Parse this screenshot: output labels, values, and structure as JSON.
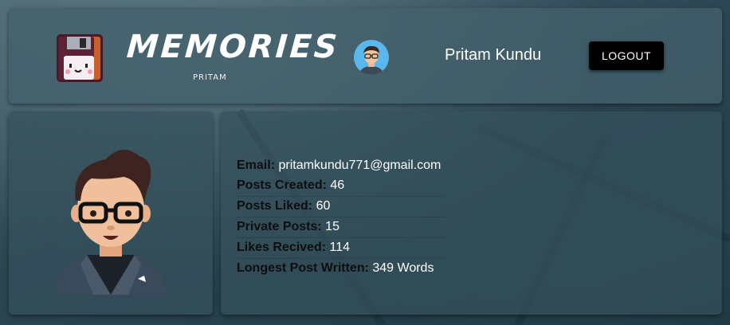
{
  "header": {
    "brand_title": "MEMORIES",
    "brand_subtitle": "PRITAM",
    "user_name": "Pritam Kundu",
    "logout_label": "LOGOUT"
  },
  "profile": {
    "email": {
      "label": "Email:",
      "value": "pritamkundu771@gmail.com"
    },
    "posts_created": {
      "label": "Posts Created:",
      "value": "46"
    },
    "posts_liked": {
      "label": "Posts Liked:",
      "value": "60"
    },
    "private_posts": {
      "label": "Private Posts:",
      "value": "15"
    },
    "likes_received": {
      "label": "Likes Recived:",
      "value": "114"
    },
    "longest_post": {
      "label": "Longest Post Written:",
      "value": "349 Words"
    }
  },
  "colors": {
    "accent_logout": "#000000",
    "text_light": "#ffffff",
    "text_dark": "#0e0e0e"
  },
  "icons": {
    "logo": "floppy-disk-icon",
    "avatar_small": "user-avatar-icon",
    "avatar_large": "user-avatar-large-icon"
  }
}
